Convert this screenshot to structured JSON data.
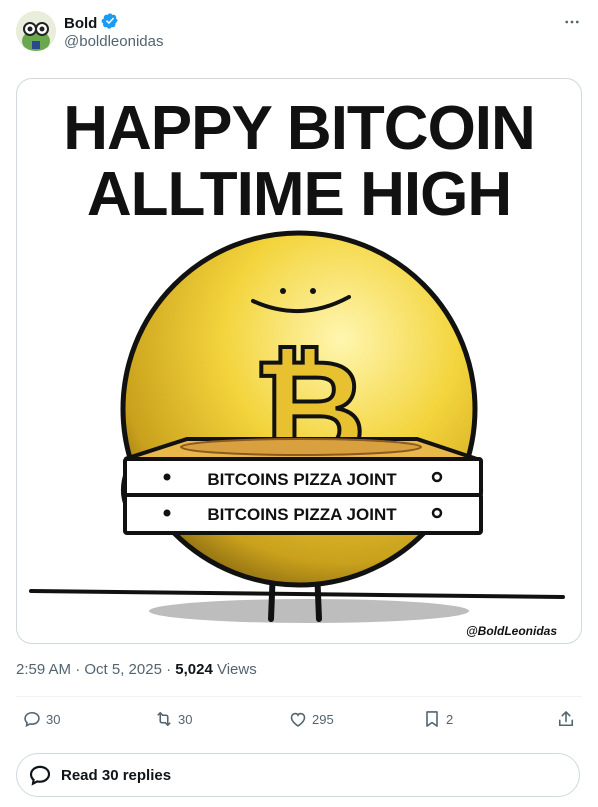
{
  "author": {
    "display_name": "Bold",
    "handle": "@boldleonidas",
    "verified": true
  },
  "media": {
    "headline_line1": "HAPPY BITCOIN",
    "headline_line2": "ALLTIME HIGH",
    "box_label_top": "BITCOINS PIZZA JOINT",
    "box_label_bottom": "BITCOINS PIZZA JOINT",
    "coin_symbol": "₿",
    "signature": "@BoldLeonidas"
  },
  "meta": {
    "timestamp": "2:59 AM · Oct 5, 2025",
    "separator": " · ",
    "views_count": "5,024",
    "views_label": " Views"
  },
  "actions": {
    "replies": "30",
    "reposts": "30",
    "likes": "295",
    "bookmarks": "2"
  },
  "read_replies_label": "Read 30 replies",
  "colors": {
    "verified": "#1d9bf0",
    "secondary_text": "#536471",
    "border": "#cfd9de",
    "coin_gold": "#f4d23a"
  }
}
